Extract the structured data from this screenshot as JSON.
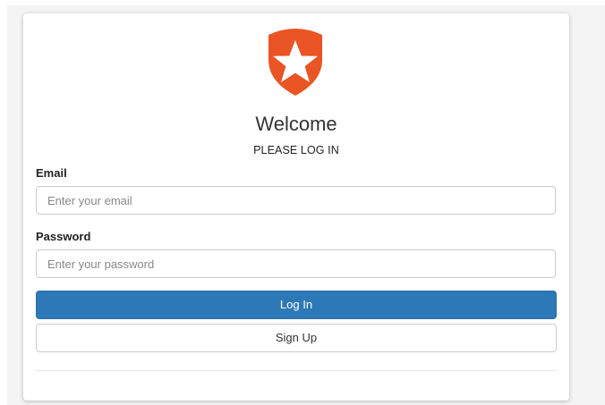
{
  "brand": {
    "logo_icon": "auth0-shield-star-icon",
    "logo_color": "#EB5424"
  },
  "header": {
    "title": "Welcome",
    "subtitle": "PLEASE LOG IN"
  },
  "form": {
    "email_label": "Email",
    "email_placeholder": "Enter your email",
    "email_value": "",
    "password_label": "Password",
    "password_placeholder": "Enter your password",
    "password_value": "",
    "login_label": "Log In",
    "signup_label": "Sign Up"
  },
  "colors": {
    "primary_button": "#2D78B7",
    "page_background": "#F4F4F4"
  }
}
